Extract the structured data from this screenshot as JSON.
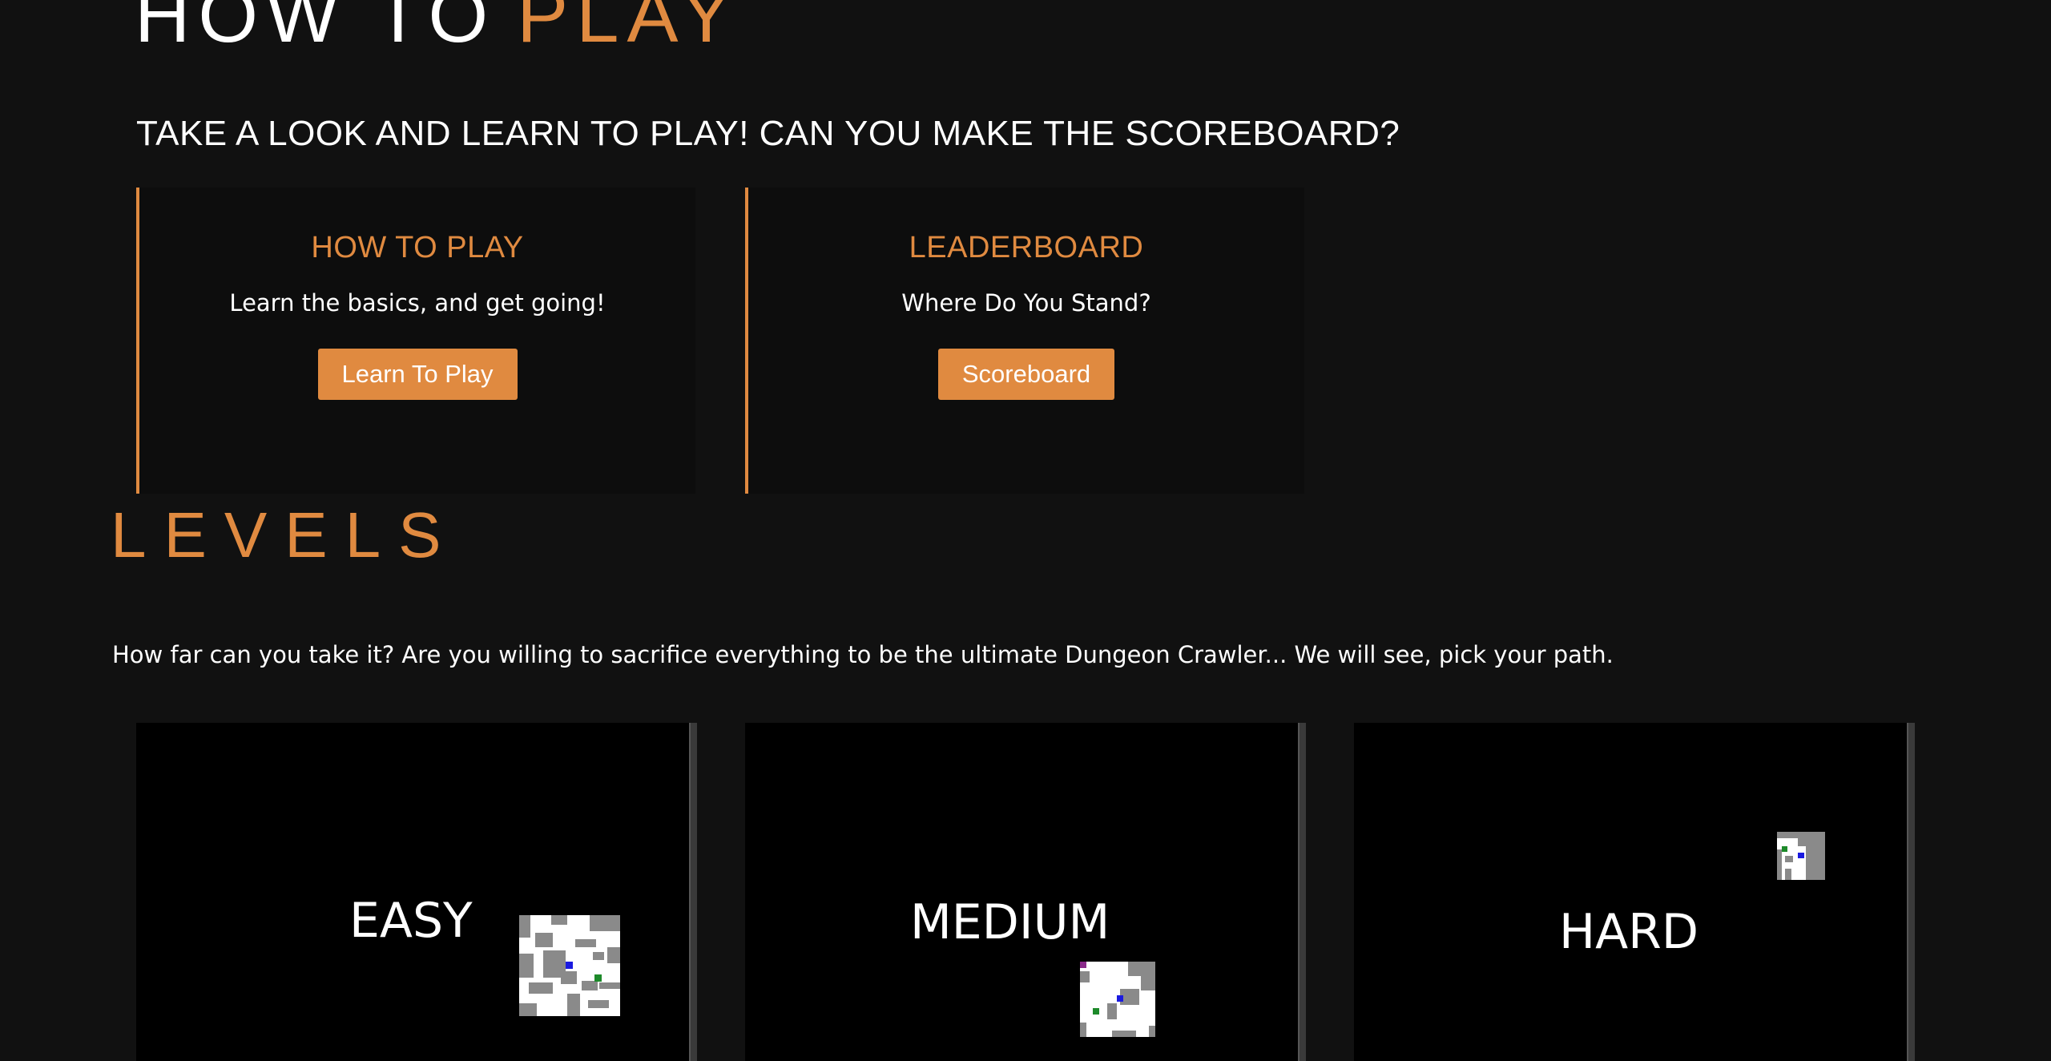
{
  "hero": {
    "title_white": "HOW TO",
    "title_orange": "PLAY"
  },
  "tagline": "TAKE A LOOK AND LEARN TO PLAY! CAN YOU MAKE THE SCOREBOARD?",
  "cards": [
    {
      "title": "HOW TO PLAY",
      "text": "Learn the basics, and get going!",
      "button": "Learn To Play"
    },
    {
      "title": "LEADERBOARD",
      "text": "Where Do You Stand?",
      "button": "Scoreboard"
    }
  ],
  "levels": {
    "title": "LEVELS",
    "description": "How far can you take it? Are you willing to sacrifice everything to be the ultimate Dungeon Crawler... We will see, pick your path.",
    "items": [
      {
        "name": "EASY"
      },
      {
        "name": "MEDIUM"
      },
      {
        "name": "HARD"
      }
    ]
  },
  "colors": {
    "accent": "#e08a40",
    "background": "#111111",
    "card": "#0d0d0d"
  }
}
